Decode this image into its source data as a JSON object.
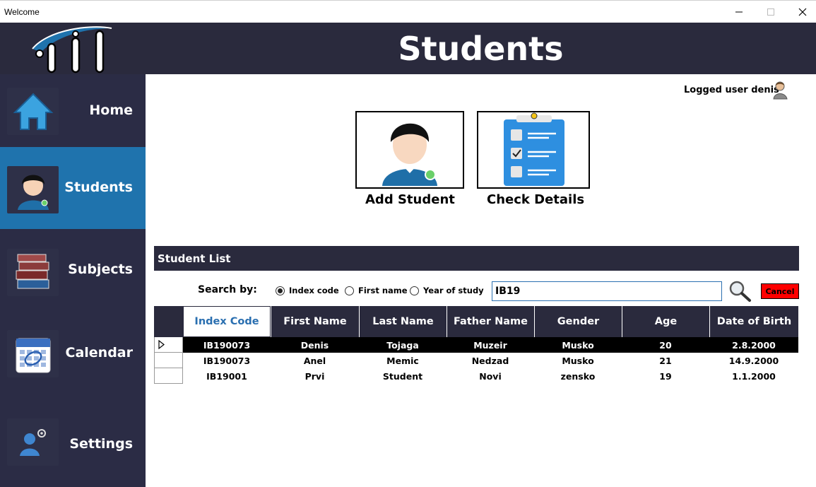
{
  "window": {
    "title": "Welcome"
  },
  "header": {
    "title": "Students"
  },
  "sidebar": {
    "items": [
      {
        "label": "Home",
        "icon": "home-icon"
      },
      {
        "label": "Students",
        "icon": "student-icon"
      },
      {
        "label": "Subjects",
        "icon": "books-icon"
      },
      {
        "label": "Calendar",
        "icon": "calendar-icon"
      },
      {
        "label": "Settings",
        "icon": "user-settings-icon"
      }
    ],
    "active": "Students"
  },
  "user": {
    "logged_text": "Logged user denis"
  },
  "actions": {
    "add_label": "Add Student",
    "check_label": "Check Details"
  },
  "student_list": {
    "title": "Student List",
    "search_by_label": "Search by:",
    "options": [
      "Index code",
      "First name",
      "Year of study"
    ],
    "selected_option": "Index code",
    "search_value": "IB19",
    "cancel_label": "Cancel",
    "columns": [
      "Index Code",
      "First Name",
      "Last Name",
      "Father Name",
      "Gender",
      "Age",
      "Date of Birth"
    ],
    "rows": [
      [
        "IB190073",
        "Denis",
        "Tojaga",
        "Muzeir",
        "Musko",
        "20",
        "2.8.2000"
      ],
      [
        "IB190073",
        "Anel",
        "Memic",
        "Nedzad",
        "Musko",
        "21",
        "14.9.2000"
      ],
      [
        "IB19001",
        "Prvi",
        "Student",
        "Novi",
        "zensko",
        "19",
        "1.1.2000"
      ]
    ]
  },
  "colors": {
    "header_bg": "#2a2a3d",
    "sidebar_bg": "#2b2c45",
    "active_bg": "#1f73ad",
    "accent": "#2a6fb0",
    "cancel": "#ff0000"
  }
}
